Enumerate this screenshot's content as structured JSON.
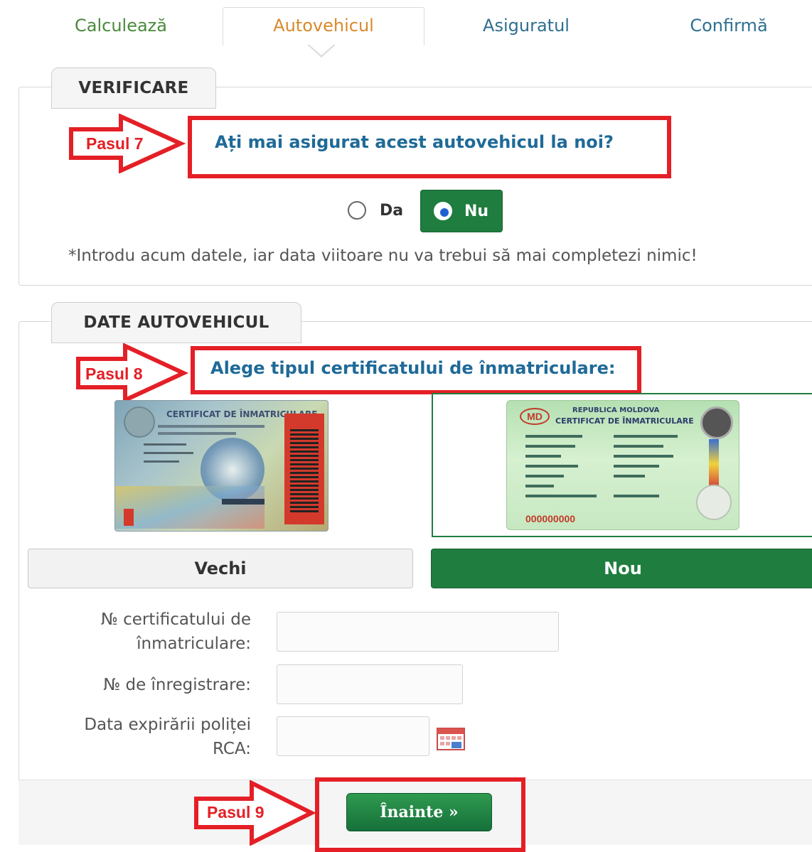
{
  "tabs": [
    {
      "label": "Calculează",
      "color": "#4a8a3c"
    },
    {
      "label": "Autovehicul",
      "color": "#d98a2b"
    },
    {
      "label": "Asiguratul",
      "color": "#2f6f8f"
    },
    {
      "label": "Confirmă",
      "color": "#2f6f8f"
    }
  ],
  "verificare": {
    "legend": "VERIFICARE",
    "step_label": "Pasul 7",
    "question": "Ați mai asigurat acest autovehicul la noi?",
    "option_da": "Da",
    "option_nu": "Nu",
    "selected": "Nu",
    "note": "*Introdu acum datele, iar data viitoare nu va trebui să mai completezi nimic!"
  },
  "date_autovehicul": {
    "legend": "DATE AUTOVEHICUL",
    "step_label": "Pasul 8",
    "question": "Alege tipul certificatului de înmatriculare:",
    "cert_old_title": "CERTIFICAT DE ÎNMATRICULARE",
    "cert_new_header": "REPUBLICA MOLDOVA",
    "cert_new_title": "CERTIFICAT DE ÎNMATRICULARE",
    "cert_new_badge": "MD",
    "cert_new_number": "000000000",
    "btn_old": "Vechi",
    "btn_new": "Nou",
    "selected": "Nou",
    "fields": [
      {
        "label_line1": "№ certificatului de",
        "label_line2": "înmatriculare:",
        "value": ""
      },
      {
        "label_line1": "№ de înregistrare:",
        "value": ""
      },
      {
        "label_line1": "Data expirării poliței",
        "label_line2": "RCA:",
        "value": ""
      }
    ]
  },
  "footer": {
    "step_label": "Pasul 9",
    "next_label": "Înainte »"
  },
  "colors": {
    "accent_green": "#1f7d3f",
    "annotation_red": "#e41f26",
    "question_blue": "#1f6a98"
  }
}
